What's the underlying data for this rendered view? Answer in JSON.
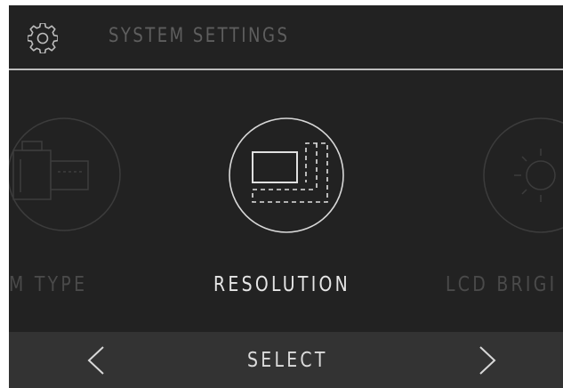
{
  "header": {
    "icon": "gear-icon",
    "title": "SYSTEM SETTINGS"
  },
  "carousel": {
    "items": [
      {
        "label": "M TYPE",
        "icon": "film-roll-icon",
        "state": "inactive"
      },
      {
        "label": "RESOLUTION",
        "icon": "resolution-icon",
        "state": "active"
      },
      {
        "label": "LCD BRIGI",
        "icon": "brightness-icon",
        "state": "inactive"
      }
    ]
  },
  "footer": {
    "prev": "<",
    "select": "SELECT",
    "next": ">"
  },
  "colors": {
    "background": "#222222",
    "footer": "#333333",
    "active_text": "#e6e6e6",
    "inactive_text": "#4a4a4a",
    "divider": "#bdbdbd"
  }
}
